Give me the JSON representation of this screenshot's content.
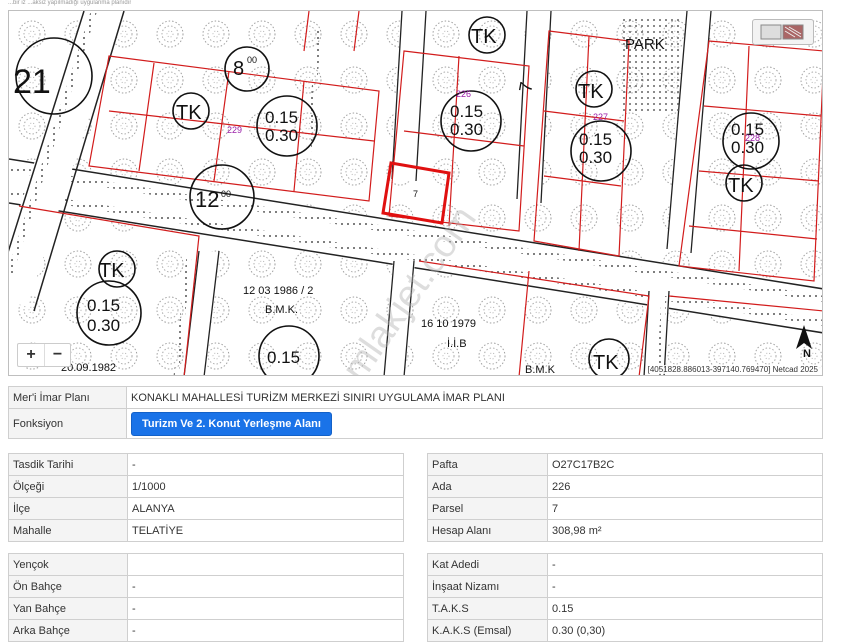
{
  "header_note": "...bir iz ...aksiz yapılmadığı uygulanma planıdır",
  "map": {
    "labels": {
      "tk": "TK",
      "park": "PARK",
      "area_large": "21",
      "d8": "8",
      "d8sup": "00",
      "d12": "12",
      "d12sup": "00",
      "d7": "7",
      "d7sup": "00",
      "ratio_top": "0.15",
      "ratio_bottom": "0.30",
      "bmk_date": "12 03 1986 / 2",
      "bmk": "B.M.K.",
      "iib_date": "16 10 1979",
      "iib": "İ.İ.B",
      "date_left": "20.09.1982",
      "bmk2": "B.M.K",
      "block_229": "229",
      "block_226": "226",
      "block_227": "227",
      "block_228": "228",
      "parcel_7": "7",
      "watermark": "emlakjet.com",
      "north": "N"
    },
    "zoom_in": "+",
    "zoom_out": "−",
    "coordinates": "[4051828.886013-397140.769470] Netcad 2025",
    "layer_icon": "layers-icon"
  },
  "plan": {
    "meri_label": "Mer'i İmar Planı",
    "meri_value": "KONAKLI MAHALLESİ TURİZM MERKEZİ SINIRI UYGULAMA İMAR PLANI",
    "fonksiyon_label": "Fonksiyon",
    "fonksiyon_value": "Turizm Ve 2. Konut Yerleşme Alanı"
  },
  "left1": [
    {
      "label": "Tasdik Tarihi",
      "value": "-"
    },
    {
      "label": "Ölçeği",
      "value": "1/1000"
    },
    {
      "label": "İlçe",
      "value": "ALANYA"
    },
    {
      "label": "Mahalle",
      "value": "TELATİYE"
    }
  ],
  "right1": [
    {
      "label": "Pafta",
      "value": "O27C17B2C"
    },
    {
      "label": "Ada",
      "value": "226"
    },
    {
      "label": "Parsel",
      "value": "7"
    },
    {
      "label": "Hesap Alanı",
      "value": "308,98 m²"
    }
  ],
  "left2": [
    {
      "label": "Yençok",
      "value": ""
    },
    {
      "label": "Ön Bahçe",
      "value": "-"
    },
    {
      "label": "Yan Bahçe",
      "value": "-"
    },
    {
      "label": "Arka Bahçe",
      "value": "-"
    }
  ],
  "right2": [
    {
      "label": "Kat Adedi",
      "value": "-"
    },
    {
      "label": "İnşaat Nizamı",
      "value": "-"
    },
    {
      "label": "T.A.K.S",
      "value": "0.15"
    },
    {
      "label": "K.A.K.S (Emsal)",
      "value": "0.30 (0,30)"
    }
  ]
}
